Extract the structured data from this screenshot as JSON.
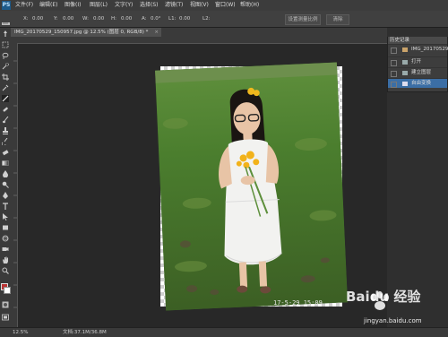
{
  "app": {
    "logo_text": "PS"
  },
  "menu": [
    {
      "label": "文件(F)"
    },
    {
      "label": "编辑(E)"
    },
    {
      "label": "图像(I)"
    },
    {
      "label": "图层(L)"
    },
    {
      "label": "文字(Y)"
    },
    {
      "label": "选择(S)"
    },
    {
      "label": "滤镜(T)"
    },
    {
      "label": "视图(V)"
    },
    {
      "label": "窗口(W)"
    },
    {
      "label": "帮助(H)"
    }
  ],
  "options": {
    "x_label": "X:",
    "x_value": "0.00",
    "y_label": "Y:",
    "y_value": "0.00",
    "w_label": "W:",
    "w_value": "0.00",
    "h_label": "H:",
    "h_value": "0.00",
    "a_label": "A:",
    "a_value": "0.0°",
    "l1_label": "L1:",
    "l1_value": "0.00",
    "l2_label": "L2:",
    "btn_set_measure": "设置测量比例",
    "btn_clear": "清除"
  },
  "document_tab": {
    "title": "IMG_20170529_150957.jpg @ 12.5% (图层 0, RGB/8) *",
    "close": "×"
  },
  "history_panel": {
    "title": "历史记录",
    "snapshot_label": "IMG_20170529_...",
    "items": [
      {
        "label": "打开"
      },
      {
        "label": "建立图层"
      },
      {
        "label": "自由变换"
      }
    ],
    "selected_index": 2
  },
  "status": {
    "zoom": "12.5%",
    "doc_info": "文档:37.1M/36.8M"
  },
  "photo": {
    "datestamp": "17-5-29 15:09"
  },
  "watermark": {
    "text": "Baidu 经验",
    "site": "jingyan.baidu.com"
  },
  "colors": {
    "accent": "#3b6ea5",
    "bg": "#2b2b2b",
    "panel": "#3d3d3d"
  }
}
